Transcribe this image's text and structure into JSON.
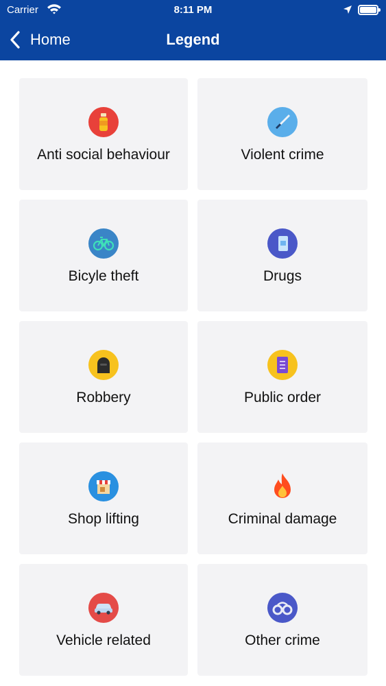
{
  "status_bar": {
    "carrier": "Carrier",
    "time": "8:11 PM"
  },
  "nav": {
    "back_label": "Home",
    "title": "Legend"
  },
  "legend": [
    {
      "label": "Anti social behaviour",
      "icon": "spray-can-icon",
      "color": "#e8413a"
    },
    {
      "label": "Violent crime",
      "icon": "knife-icon",
      "color": "#5aaeea"
    },
    {
      "label": "Bicyle theft",
      "icon": "bicycle-icon",
      "color": "#3a85c7"
    },
    {
      "label": "Drugs",
      "icon": "drugs-icon",
      "color": "#4a58c8"
    },
    {
      "label": "Robbery",
      "icon": "robber-icon",
      "color": "#f7c21e"
    },
    {
      "label": "Public order",
      "icon": "document-icon",
      "color": "#f7c21e"
    },
    {
      "label": "Shop lifting",
      "icon": "shop-icon",
      "color": "#2a90e0"
    },
    {
      "label": "Criminal damage",
      "icon": "fire-icon",
      "color": "#ff5a1f"
    },
    {
      "label": "Vehicle related",
      "icon": "car-icon",
      "color": "#e44b48"
    },
    {
      "label": "Other crime",
      "icon": "handcuffs-icon",
      "color": "#4a58c8"
    }
  ]
}
